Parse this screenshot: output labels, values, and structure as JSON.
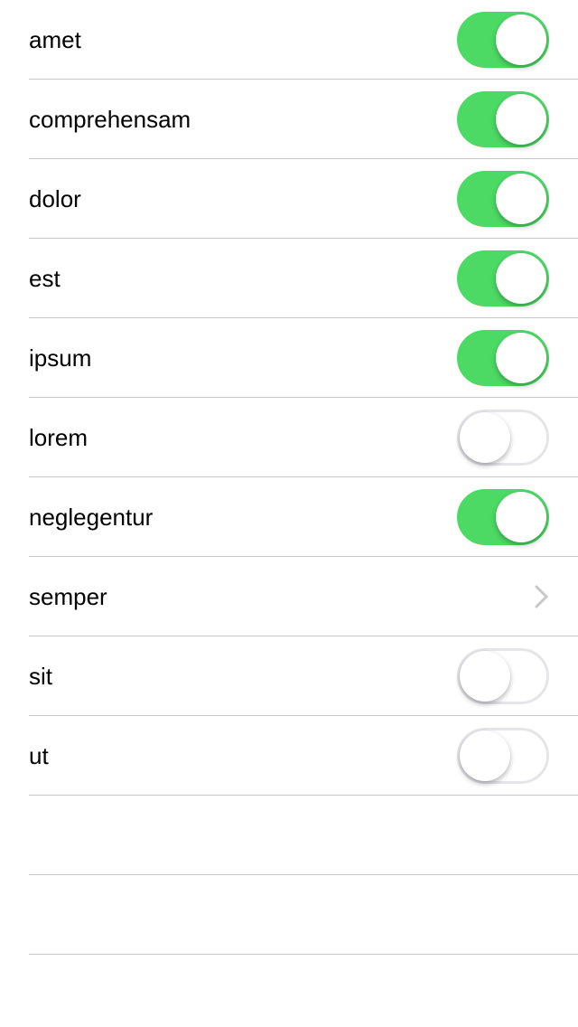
{
  "settings": {
    "items": [
      {
        "label": "amet",
        "control": "toggle",
        "on": true
      },
      {
        "label": "comprehensam",
        "control": "toggle",
        "on": true
      },
      {
        "label": "dolor",
        "control": "toggle",
        "on": true
      },
      {
        "label": "est",
        "control": "toggle",
        "on": true
      },
      {
        "label": "ipsum",
        "control": "toggle",
        "on": true
      },
      {
        "label": "lorem",
        "control": "toggle",
        "on": false
      },
      {
        "label": "neglegentur",
        "control": "toggle",
        "on": true
      },
      {
        "label": "semper",
        "control": "disclosure",
        "icon": "chevron-right-icon"
      },
      {
        "label": "sit",
        "control": "toggle",
        "on": false
      },
      {
        "label": "ut",
        "control": "toggle",
        "on": false
      },
      {
        "label": "",
        "control": "none"
      },
      {
        "label": "",
        "control": "none"
      }
    ]
  },
  "colors": {
    "toggle_on": "#4cd964",
    "toggle_off_border": "#e5e5ea",
    "separator": "#c8c7cc",
    "chevron": "#c7c7cc"
  }
}
